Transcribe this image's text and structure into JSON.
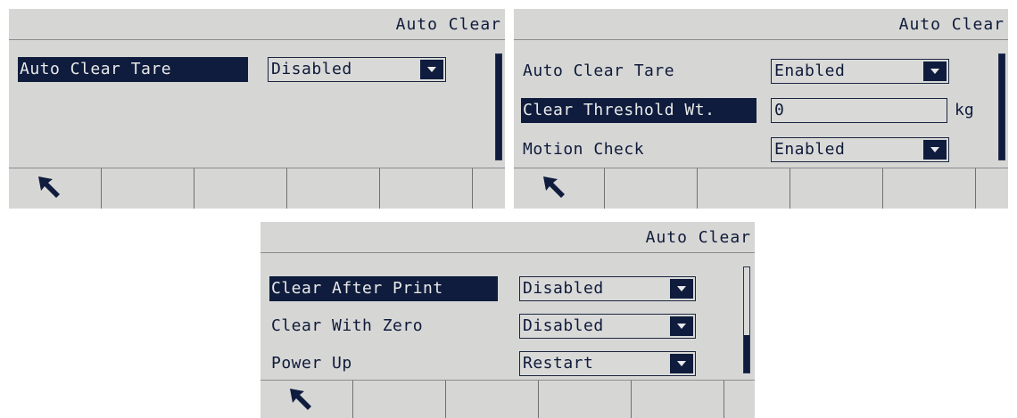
{
  "screens": [
    {
      "title": "Auto Clear",
      "fields": [
        {
          "label": "Auto Clear Tare",
          "value": "Disabled",
          "selected": true
        }
      ],
      "softkeys": [
        {
          "icon": "back-arrow-icon"
        },
        {},
        {},
        {},
        {},
        {}
      ]
    },
    {
      "title": "Auto Clear",
      "fields": [
        {
          "label": "Auto Clear Tare",
          "value": "Enabled",
          "selected": false
        },
        {
          "label": "Clear Threshold Wt.",
          "value": "0",
          "unit": "kg",
          "selected": true
        },
        {
          "label": "Motion Check",
          "value": "Enabled",
          "selected": false
        }
      ],
      "softkeys": [
        {
          "icon": "back-arrow-icon"
        },
        {},
        {},
        {},
        {},
        {}
      ]
    },
    {
      "title": "Auto Clear",
      "fields": [
        {
          "label": "Clear After Print",
          "value": "Disabled",
          "selected": true
        },
        {
          "label": "Clear With Zero",
          "value": "Disabled",
          "selected": false
        },
        {
          "label": "Power Up",
          "value": "Restart",
          "selected": false
        }
      ],
      "softkeys": [
        {
          "icon": "back-arrow-icon"
        },
        {},
        {},
        {},
        {},
        {}
      ]
    }
  ]
}
